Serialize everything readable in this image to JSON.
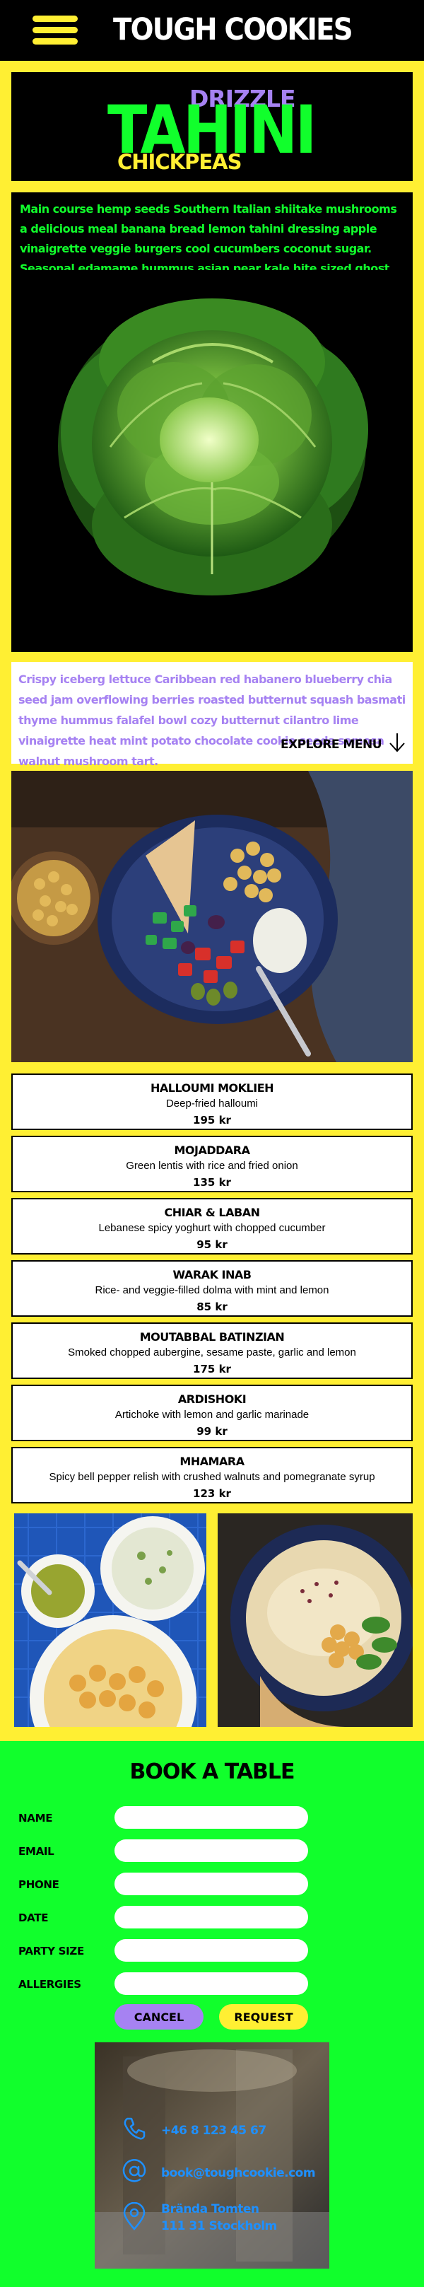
{
  "header": {
    "brand": "TOUGH COOKIES"
  },
  "hero": {
    "drizzle": "DRIZZLE",
    "tahini": "TAHINI",
    "chickpeas": "CHICKPEAS"
  },
  "intro": {
    "text": "Main course hemp seeds Southern Italian shiitake mushrooms a delicious meal banana bread lemon tahini dressing apple vinaigrette veggie burgers cool cucumbers coconut sugar. Seasonal edamame hummus asian pear kale bite sized ghost pepper one bowl mediterranean luxury bowl cayenne Thai sun pepper."
  },
  "about": {
    "text": "Crispy iceberg lettuce Caribbean red habanero blueberry chia seed jam overflowing berries roasted butternut squash basmati thyme hummus falafel bowl cozy butternut cilantro lime vinaigrette heat mint potato chocolate cookie seeds samosa walnut mushroom tart.",
    "explore_label": "EXPLORE MENU"
  },
  "menu": {
    "items": [
      {
        "name": "HALLOUMI MOKLIEH",
        "desc": "Deep-fried halloumi",
        "price": "195 kr"
      },
      {
        "name": "MOJADDARA",
        "desc": "Green lentis with rice and fried onion",
        "price": "135 kr"
      },
      {
        "name": "CHIAR & LABAN",
        "desc": "Lebanese spicy yoghurt with chopped cucumber",
        "price": "95 kr"
      },
      {
        "name": "WARAK INAB",
        "desc": "Rice- and veggie-filled dolma with mint and lemon",
        "price": "85 kr"
      },
      {
        "name": "MOUTABBAL BATINZIAN",
        "desc": "Smoked chopped aubergine, sesame paste, garlic and lemon",
        "price": "175 kr"
      },
      {
        "name": "ARDISHOKI",
        "desc": "Artichoke with lemon and garlic marinade",
        "price": "99 kr"
      },
      {
        "name": "MHAMARA",
        "desc": "Spicy bell pepper relish with crushed walnuts and pomegranate syrup",
        "price": "123 kr"
      }
    ]
  },
  "booking": {
    "title": "BOOK A TABLE",
    "fields": {
      "name": {
        "label": "NAME",
        "value": ""
      },
      "email": {
        "label": "EMAIL",
        "value": ""
      },
      "phone": {
        "label": "PHONE",
        "value": ""
      },
      "date": {
        "label": "DATE",
        "value": ""
      },
      "party_size": {
        "label": "PARTY SIZE",
        "value": ""
      },
      "allergies": {
        "label": "ALLERGIES",
        "value": ""
      }
    },
    "cancel_label": "CANCEL",
    "request_label": "REQUEST"
  },
  "contact": {
    "phone": "+46 8 123 45 67",
    "email": "book@toughcookie.com",
    "address_line1": "Brända Tomten",
    "address_line2": "111 31 Stockholm"
  },
  "icons": {
    "menu": "hamburger-menu-icon",
    "explore": "arrow-down-icon",
    "phone": "phone-icon",
    "email": "at-sign-icon",
    "address": "map-pin-icon"
  },
  "colors": {
    "yellow": "#ffef33",
    "green": "#11ff2c",
    "purple": "#a682f2",
    "black": "#000000",
    "link_blue": "#1e90ff"
  }
}
